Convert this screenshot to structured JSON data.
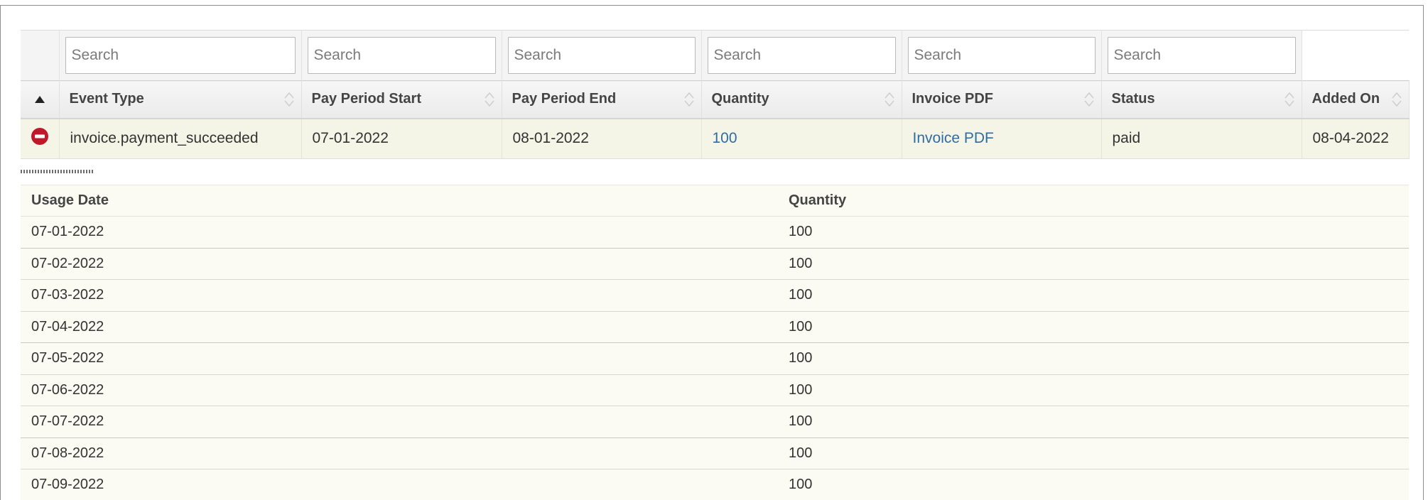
{
  "filters": {
    "placeholder": "Search"
  },
  "columns": [
    {
      "label": "Event Type"
    },
    {
      "label": "Pay Period Start"
    },
    {
      "label": "Pay Period End"
    },
    {
      "label": "Quantity"
    },
    {
      "label": "Invoice PDF"
    },
    {
      "label": "Status"
    },
    {
      "label": "Added On"
    }
  ],
  "row": {
    "event_type": "invoice.payment_succeeded",
    "pay_period_start": "07-01-2022",
    "pay_period_end": "08-01-2022",
    "quantity": "100",
    "invoice_pdf": "Invoice PDF",
    "status": "paid",
    "added_on": "08-04-2022"
  },
  "usage": {
    "headers": [
      "Usage Date",
      "Quantity"
    ],
    "rows": [
      {
        "date": "07-01-2022",
        "quantity": "100"
      },
      {
        "date": "07-02-2022",
        "quantity": "100"
      },
      {
        "date": "07-03-2022",
        "quantity": "100"
      },
      {
        "date": "07-04-2022",
        "quantity": "100"
      },
      {
        "date": "07-05-2022",
        "quantity": "100"
      },
      {
        "date": "07-06-2022",
        "quantity": "100"
      },
      {
        "date": "07-07-2022",
        "quantity": "100"
      },
      {
        "date": "07-08-2022",
        "quantity": "100"
      },
      {
        "date": "07-09-2022",
        "quantity": "100"
      }
    ]
  },
  "colors": {
    "link": "#2e6da4",
    "collapse_icon": "#c0182b",
    "row_highlight": "#f4f5e6"
  },
  "icons": {
    "collapse": "collapse-row-icon",
    "sort": "sort-both-icon",
    "sort_asc": "sort-asc-icon"
  }
}
